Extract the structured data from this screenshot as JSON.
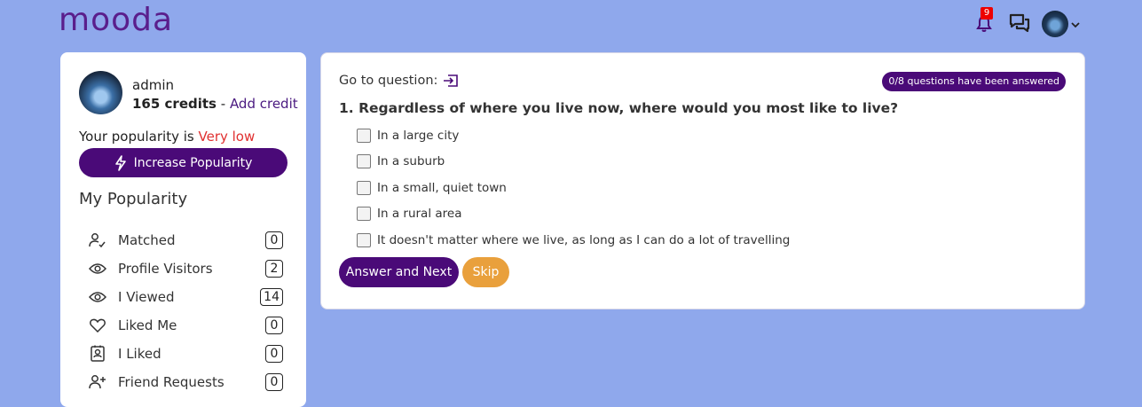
{
  "header": {
    "logo": "mooda",
    "notifications_count": "9"
  },
  "profile": {
    "name": "admin",
    "credits": "165 credits",
    "separator": " - ",
    "add_credit": "Add credit",
    "popularity_prefix": "Your popularity is ",
    "popularity_value": "Very low",
    "increase_label": "Increase Popularity"
  },
  "my_popularity": {
    "title": "My Popularity",
    "items": [
      {
        "label": "Matched",
        "count": "0",
        "icon": "user-check-icon"
      },
      {
        "label": "Profile Visitors",
        "count": "2",
        "icon": "eye-icon"
      },
      {
        "label": "I Viewed",
        "count": "14",
        "icon": "eye-icon"
      },
      {
        "label": "Liked Me",
        "count": "0",
        "icon": "heart-icon"
      },
      {
        "label": "I Liked",
        "count": "0",
        "icon": "contact-card-icon"
      },
      {
        "label": "Friend Requests",
        "count": "0",
        "icon": "user-plus-icon"
      }
    ]
  },
  "questionnaire": {
    "goto_label": "Go to question:",
    "answered_badge": "0/8 questions have been answered",
    "question": "1. Regardless of where you live now, where would you most like to live?",
    "options": [
      "In a large city",
      "In a suburb",
      "In a small, quiet town",
      "In a rural area",
      "It doesn't matter where we live, as long as I can do a lot of travelling"
    ],
    "answer_button": "Answer and Next",
    "skip_button": "Skip"
  },
  "colors": {
    "background": "#8fa8ec",
    "primary": "#4a0a78",
    "skip": "#e9a03c",
    "warning": "#e03030"
  }
}
